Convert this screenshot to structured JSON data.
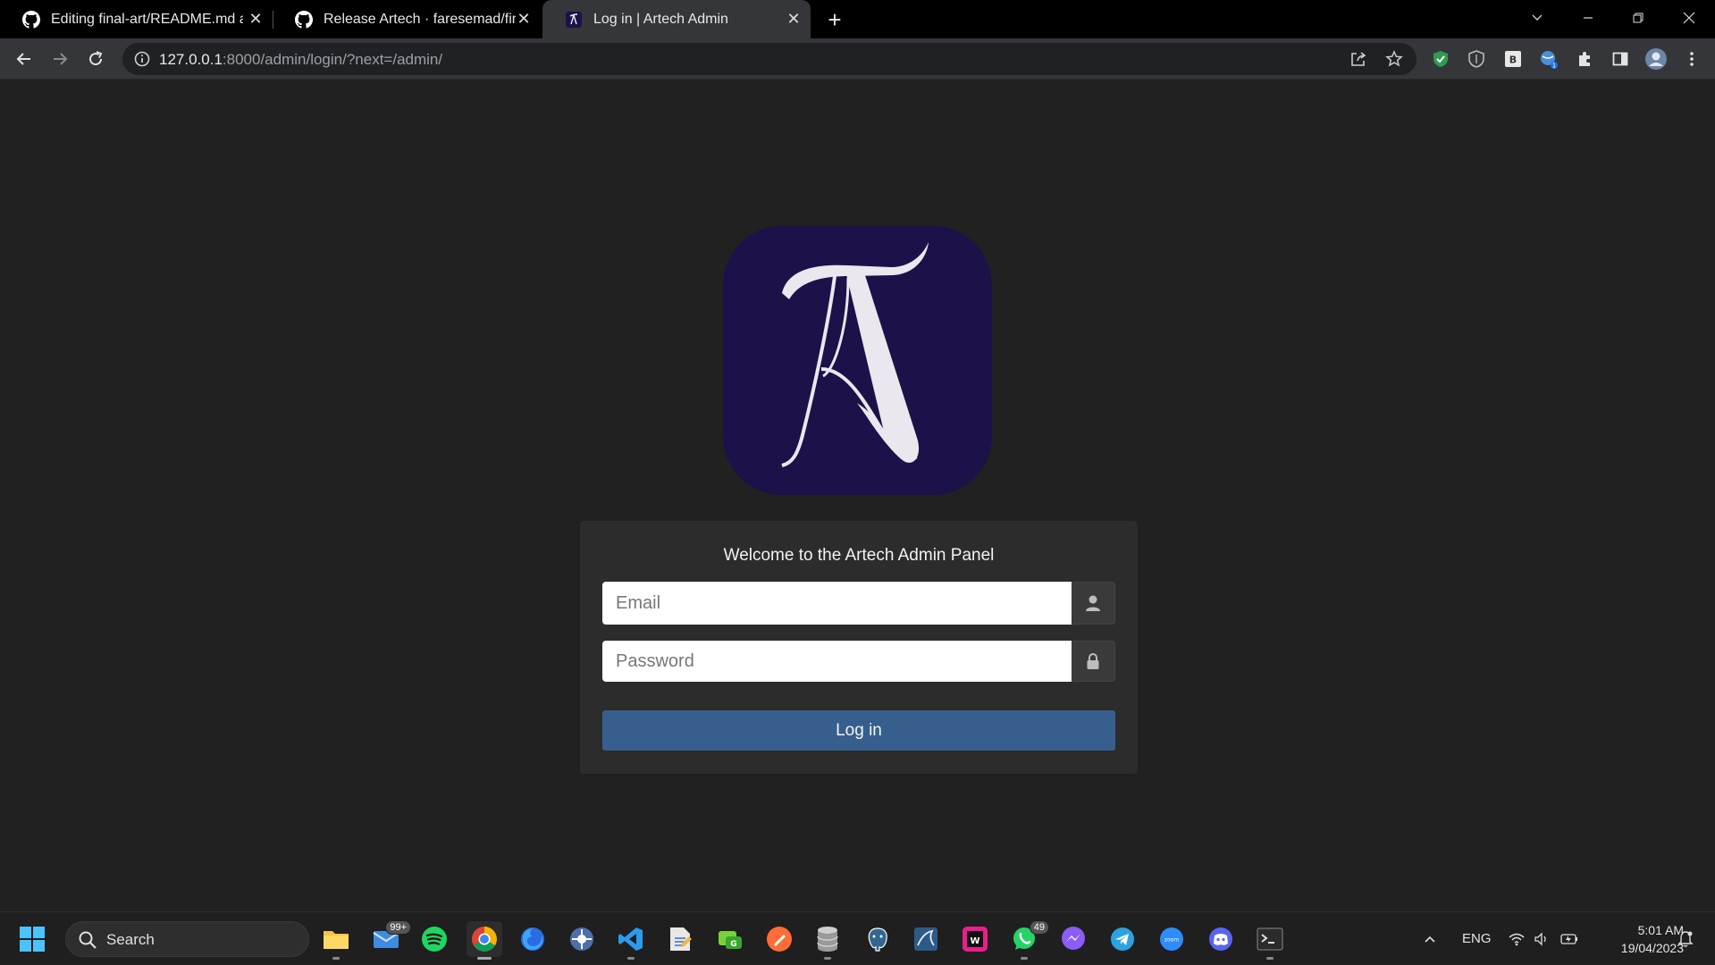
{
  "browser": {
    "tabs": [
      {
        "title": "Editing final-art/README.md at main",
        "icon": "github-icon",
        "active": false
      },
      {
        "title": "Release Artech · faresemad/final-art",
        "icon": "github-icon",
        "active": false
      },
      {
        "title": "Log in | Artech Admin",
        "icon": "artech-favicon",
        "active": true
      }
    ],
    "address": {
      "host": "127.0.0.1",
      "rest": ":8000/admin/login/?next=/admin/"
    }
  },
  "page": {
    "welcome": "Welcome to the Artech Admin Panel",
    "email_placeholder": "Email",
    "password_placeholder": "Password",
    "login_label": "Log in",
    "colors": {
      "logo_bg": "#1c1148",
      "button": "#365f8d",
      "card": "#2c2c2c",
      "background": "#212121"
    }
  },
  "taskbar": {
    "search_label": "Search",
    "mail_badge": "99+",
    "whatsapp_badge": "49",
    "language": "ENG",
    "time": "5:01 AM",
    "date": "19/04/2023",
    "apps": [
      "file-explorer-icon",
      "mail-icon",
      "spotify-icon",
      "chrome-icon",
      "firefox-icon",
      "app-icon",
      "vscode-icon",
      "notepad-icon",
      "git-icon",
      "postman-icon",
      "database-icon",
      "postgres-icon",
      "mysql-icon",
      "webstorm-icon",
      "whatsapp-icon",
      "messenger-icon",
      "telegram-icon",
      "zoom-icon",
      "discord-icon",
      "terminal-icon"
    ]
  }
}
